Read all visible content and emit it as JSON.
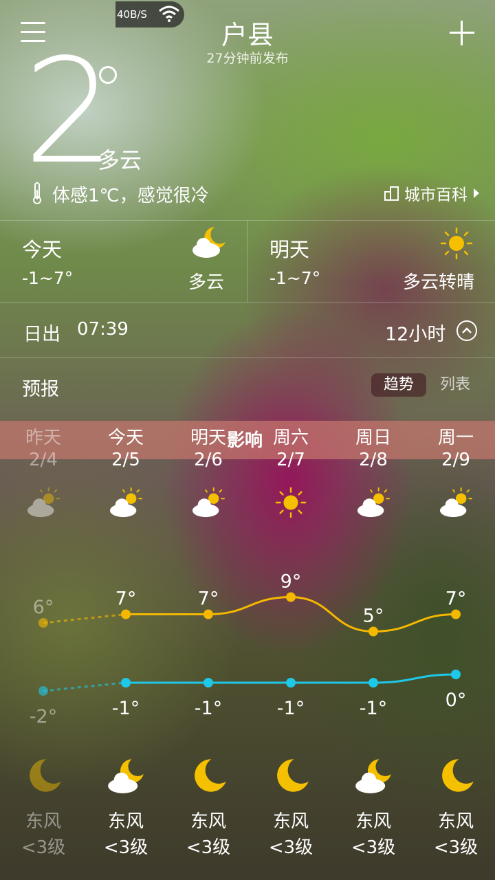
{
  "status": {
    "speed": "40B/S"
  },
  "header": {
    "city": "户县",
    "published": "27分钟前发布"
  },
  "current": {
    "temp": "2",
    "condition": "多云",
    "feels": "体感1℃，感觉很冷",
    "wiki": "城市百科"
  },
  "today": {
    "label": "今天",
    "range": "-1~7°",
    "condition": "多云"
  },
  "tomorrow": {
    "label": "明天",
    "range": "-1~7°",
    "condition": "多云转晴"
  },
  "sun": {
    "label": "日出",
    "time": "07:39",
    "hours": "12小时"
  },
  "forecast": {
    "title": "预报",
    "tab_trend": "趋势",
    "tab_list": "列表",
    "banner": "影响",
    "days": [
      {
        "name": "昨天",
        "date": "2/4",
        "high": "6°",
        "low": "-2°",
        "day_icon": "partly-cloudy-icon",
        "night_icon": "moon-icon",
        "wind": "东风",
        "level": "<3级"
      },
      {
        "name": "今天",
        "date": "2/5",
        "high": "7°",
        "low": "-1°",
        "day_icon": "partly-cloudy-icon",
        "night_icon": "cloudy-moon-icon",
        "wind": "东风",
        "level": "<3级"
      },
      {
        "name": "明天",
        "date": "2/6",
        "high": "7°",
        "low": "-1°",
        "day_icon": "partly-cloudy-icon",
        "night_icon": "moon-icon",
        "wind": "东风",
        "level": "<3级"
      },
      {
        "name": "周六",
        "date": "2/7",
        "high": "9°",
        "low": "-1°",
        "day_icon": "sun-icon",
        "night_icon": "moon-icon",
        "wind": "东风",
        "level": "<3级"
      },
      {
        "name": "周日",
        "date": "2/8",
        "high": "5°",
        "low": "-1°",
        "day_icon": "partly-cloudy-icon",
        "night_icon": "cloudy-moon-icon",
        "wind": "东风",
        "level": "<3级"
      },
      {
        "name": "周一",
        "date": "2/9",
        "high": "7°",
        "low": "0°",
        "day_icon": "partly-cloudy-icon",
        "night_icon": "moon-icon",
        "wind": "东风",
        "level": "<3级"
      }
    ]
  },
  "chart_data": {
    "type": "line",
    "categories": [
      "2/4",
      "2/5",
      "2/6",
      "2/7",
      "2/8",
      "2/9"
    ],
    "series": [
      {
        "values": [
          6,
          7,
          7,
          9,
          5,
          7
        ],
        "color": "#f5b800"
      },
      {
        "values": [
          -2,
          -1,
          -1,
          -1,
          -1,
          0
        ],
        "color": "#1ec8e8"
      }
    ]
  }
}
